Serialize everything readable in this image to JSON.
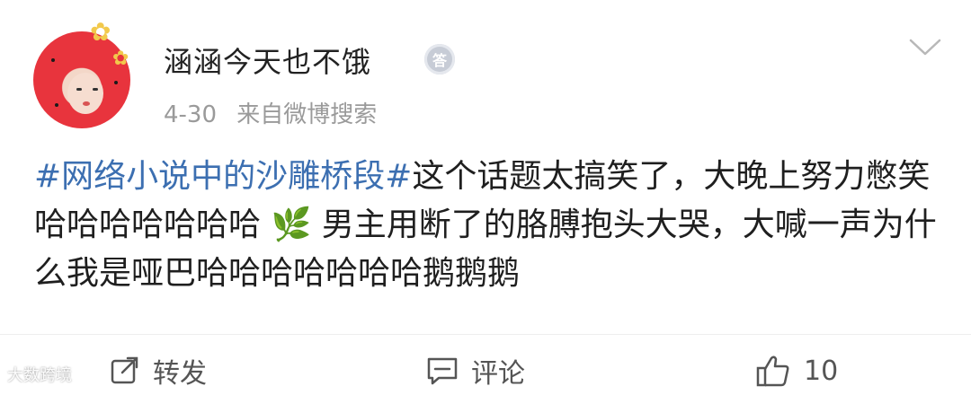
{
  "post": {
    "author": "涵涵今天也不饿",
    "badge_char": "答",
    "date": "4-30",
    "source": "来自微博搜索",
    "topic": "#网络小说中的沙雕桥段#",
    "text_part1": "这个话题太搞笑了，大晚上努力憋笑哈哈哈哈哈哈哈",
    "leaf_emoji": "🌿",
    "text_part2": "男主用断了的胳膊抱头大哭，大喊一声为什么我是哑巴哈哈哈哈哈哈哈鹅鹅鹅"
  },
  "actions": {
    "repost_label": "转发",
    "comment_label": "评论",
    "like_count": "10"
  },
  "watermark": {
    "text": "大数跨境"
  },
  "colors": {
    "topic": "#3c6fb1",
    "meta": "#9a9a9a",
    "avatar_bg": "#e8343d"
  }
}
